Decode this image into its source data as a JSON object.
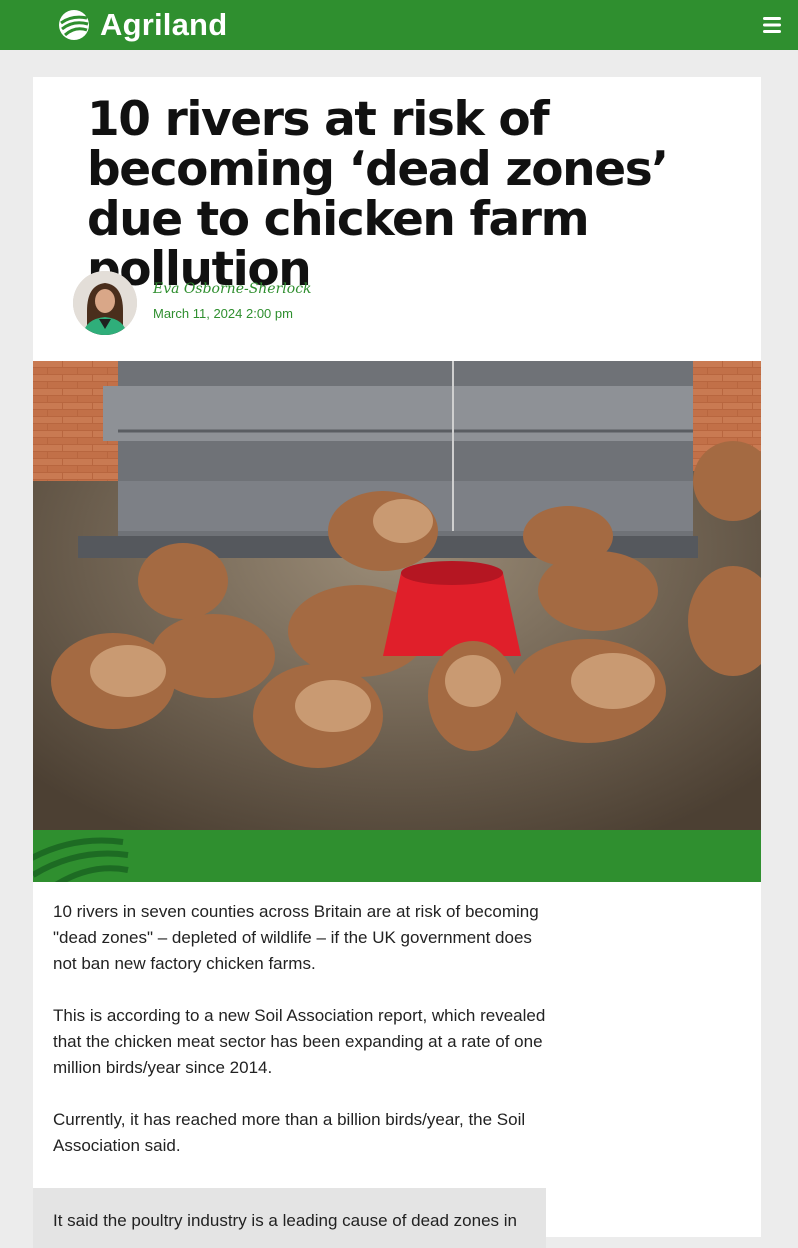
{
  "header": {
    "logo_text": "Agriland",
    "brand_color": "#2f8f2f",
    "menu_icon": "hamburger-menu-icon"
  },
  "article": {
    "title": "10 rivers at risk of becoming ‘dead zones’ due to chicken farm pollution",
    "author": "Eva Osborne-Sherlock",
    "date": "March 11, 2024 2:00 pm",
    "paragraphs": [
      "10 rivers in seven counties across Britain are at risk of becoming \"dead zones\" – depleted of wildlife – if the UK government does not ban new factory chicken farms.",
      "This is according to a new Soil Association report, which revealed that the chicken meat sector has been expanding at a rate of one million birds/year since 2014.",
      "Currently, it has reached more than a billion birds/year, the Soil Association said."
    ],
    "quote": "It said the poultry industry is a leading cause of dead zones in"
  }
}
